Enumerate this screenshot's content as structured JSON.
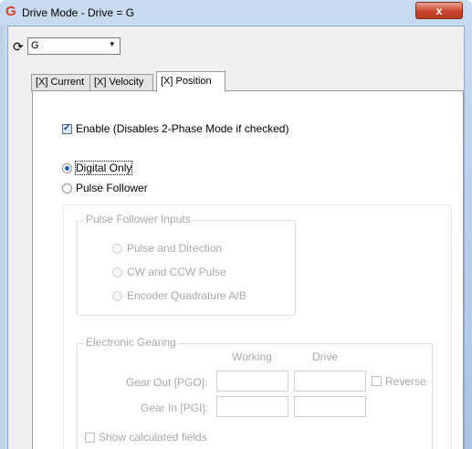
{
  "window": {
    "title": "Drive Mode - Drive = G",
    "close_label": "x",
    "logo_glyph": "G",
    "accent_color": "#e03a2a"
  },
  "toolbar": {
    "refresh_icon": "refresh-icon",
    "drive_select": {
      "value": "G",
      "arrow": "▾"
    }
  },
  "tabs": [
    {
      "label": "[X] Current",
      "active": false
    },
    {
      "label": "[X] Velocity",
      "active": false
    },
    {
      "label": "[X] Position",
      "active": true
    }
  ],
  "position_tab": {
    "enable": {
      "label": "Enable (Disables 2-Phase Mode if checked)",
      "checked": true
    },
    "mode": {
      "digital_only": {
        "label": "Digital Only",
        "selected": true
      },
      "pulse_follower": {
        "label": "Pulse Follower",
        "selected": false
      }
    },
    "pulse_follower_inputs": {
      "legend": "Pulse Follower Inputs",
      "options": [
        {
          "label": "Pulse and Direction"
        },
        {
          "label": "CW and CCW Pulse"
        },
        {
          "label": "Encoder Quadrature A/B"
        }
      ]
    },
    "electronic_gearing": {
      "legend": "Electronic Gearing",
      "col_working": "Working",
      "col_drive": "Drive",
      "gear_out_label": "Gear Out [PGO]:",
      "gear_in_label": "Gear In [PGI]:",
      "gear_out_working": "",
      "gear_out_drive": "",
      "gear_in_working": "",
      "gear_in_drive": "",
      "reverse_label": "Reverse",
      "show_calculated_label": "Show calculated fields"
    }
  }
}
